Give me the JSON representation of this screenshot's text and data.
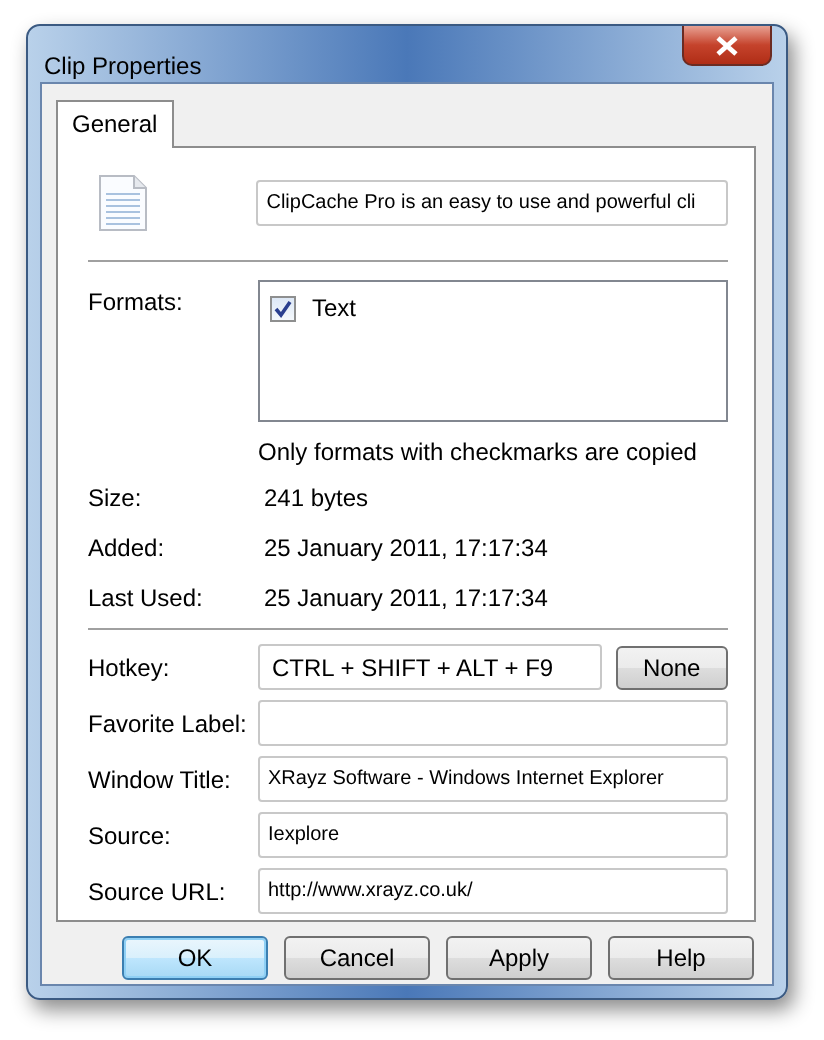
{
  "window": {
    "title": "Clip Properties"
  },
  "tabs": [
    {
      "label": "General",
      "selected": true
    }
  ],
  "description": {
    "value": "ClipCache Pro is an easy to use and powerful cli"
  },
  "formats": {
    "label": "Formats:",
    "items": [
      {
        "label": "Text",
        "checked": true
      }
    ],
    "note": "Only formats with checkmarks are copied"
  },
  "info": [
    {
      "label": "Size:",
      "value": "241 bytes"
    },
    {
      "label": "Added:",
      "value": "25 January 2011, 17:17:34"
    },
    {
      "label": "Last Used:",
      "value": "25 January 2011, 17:17:34"
    }
  ],
  "hotkey": {
    "label": "Hotkey:",
    "value": "CTRL + SHIFT + ALT + F9",
    "button": "None"
  },
  "fields": [
    {
      "label": "Favorite Label:"
    },
    {
      "label": "Window Title:",
      "value": "XRayz Software - Windows Internet Explorer"
    },
    {
      "label": "Source:",
      "value": "Iexplore"
    },
    {
      "label": "Source URL:",
      "value": "http://www.xrayz.co.uk/"
    }
  ],
  "buttons": [
    {
      "label": "OK",
      "default": true
    },
    {
      "label": "Cancel",
      "default": false
    },
    {
      "label": "Apply",
      "default": false
    },
    {
      "label": "Help",
      "default": false
    }
  ]
}
